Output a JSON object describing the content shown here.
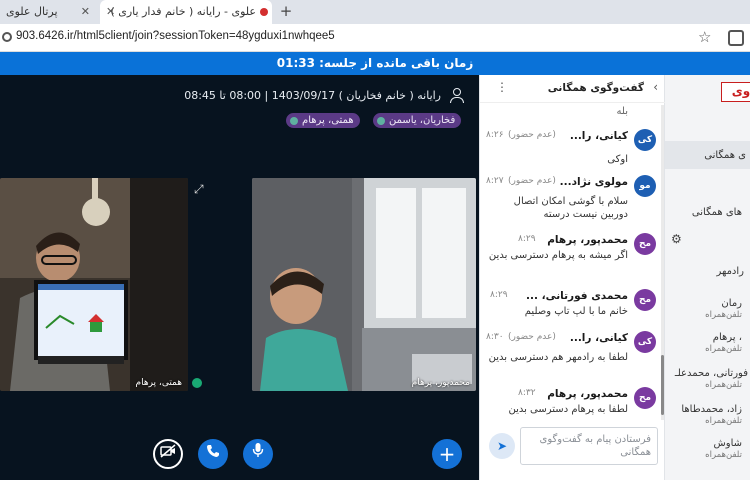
{
  "browser": {
    "tabs": [
      {
        "label": "پرتال علوی",
        "close": "✕"
      },
      {
        "label": "علوی - رایانه ( خانم فدار یاری )",
        "close": "✕"
      }
    ],
    "new_tab": "+",
    "url": "903.6426.ir/html5client/join?sessionToken=48ygduxi1nwhqee5"
  },
  "banner": {
    "text": "زمان باقی مانده از جلسه: 01:33"
  },
  "meeting": {
    "title": "رایانه ( خانم فخاریان ) 1403/09/17 | 08:00 تا 08:45",
    "talkers": [
      "فخاریان، یاسمن",
      "همتی، پرهام"
    ]
  },
  "videos": [
    {
      "name": "همتی، پرهام"
    },
    {
      "name": "محمدپور، پرهام"
    }
  ],
  "chat": {
    "title": "گفت‌وگوی همگانی",
    "back": "‹",
    "more": "⋮",
    "truncated_top": "بله",
    "messages": [
      {
        "initials": "کی",
        "sender": "کیانی، را...",
        "note": "(عدم حضور)",
        "time": "۸:۲۶",
        "text": "اوکی"
      },
      {
        "initials": "مو",
        "sender": "مولوی نژاد...",
        "note": "(عدم حضور)",
        "time": "۸:۲۷",
        "text": "سلام با گوشی امکان اتصال دوربین نیست درسته"
      },
      {
        "initials": "مح",
        "sender": "محمدپور، پرهام",
        "note": "",
        "time": "۸:۲۹",
        "text": "اگر میشه به پرهام دسترسی بدین"
      },
      {
        "initials": "مح",
        "sender": "محمدی فورتانی، ...",
        "note": "",
        "time": "۸:۲۹",
        "text": "خانم ما با لپ تاپ وصلیم"
      },
      {
        "initials": "کی",
        "sender": "کیانی، را...",
        "note": "(عدم حضور)",
        "time": "۸:۳۰",
        "text": "لطفا به رادمهر هم دسترسی بدین"
      },
      {
        "initials": "مح",
        "sender": "محمدپور، پرهام",
        "note": "",
        "time": "۸:۳۲",
        "text": "لطفا به پرهام دسترسی بدین"
      }
    ],
    "composer_placeholder": "فرستادن پیام به گفت‌وگوی همگانی"
  },
  "user_list": {
    "logo": "وی",
    "items": [
      "ی همگانی",
      "های همگانی",
      "رادمهر",
      "رمان",
      "، پرهام",
      "فورتانی، محمدعلـ",
      "زاد، محمدطاها",
      "شاوش"
    ],
    "subs": [
      "تلفن‌همراه",
      "تلفن‌همراه",
      "تلفن‌همراه",
      "تلفن‌همراه",
      "تلفن‌همراه"
    ]
  },
  "colors": {
    "banner": "#0a72d8",
    "main_bg": "#07131f",
    "talker_bg": "#5b3a86",
    "avatar_blue": "#1e5fb3",
    "avatar_purple": "#7a3aa0",
    "button_blue": "#1471d6"
  },
  "icons": [
    "close-icon",
    "plus-icon",
    "star-icon",
    "user-icon",
    "expand-icon",
    "camera-off-icon",
    "phone-icon",
    "microphone-icon",
    "send-icon",
    "gear-icon",
    "more-icon",
    "chevron-icon"
  ]
}
